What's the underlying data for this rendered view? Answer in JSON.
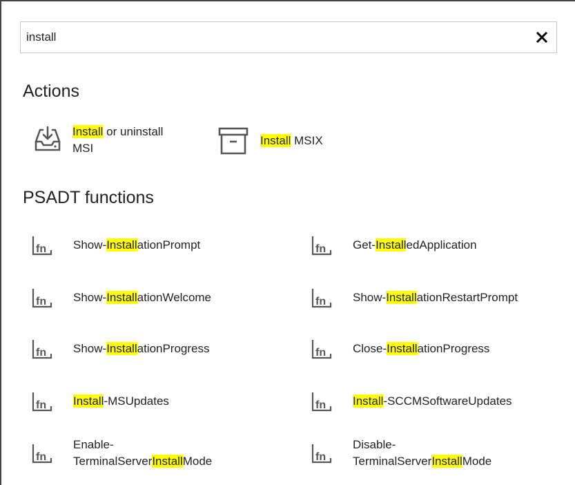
{
  "search": {
    "value": "install",
    "clear_icon": "close-icon"
  },
  "sections": {
    "actions_title": "Actions",
    "functions_title": "PSADT functions"
  },
  "actions": [
    {
      "icon": "tray-download-icon",
      "match": "Install",
      "rest": " or uninstall",
      "line2": "MSI"
    },
    {
      "icon": "archive-box-icon",
      "match": "Install",
      "rest": " MSIX",
      "line2": ""
    }
  ],
  "functions": [
    {
      "pre": "Show-",
      "match": "Install",
      "post": "ationPrompt",
      "pre2": ""
    },
    {
      "pre": "Get-",
      "match": "Install",
      "post": "edApplication",
      "pre2": ""
    },
    {
      "pre": "Show-",
      "match": "Install",
      "post": "ationWelcome",
      "pre2": ""
    },
    {
      "pre": "Show-",
      "match": "Install",
      "post": "ationRestartPrompt",
      "pre2": ""
    },
    {
      "pre": "Show-",
      "match": "Install",
      "post": "ationProgress",
      "pre2": ""
    },
    {
      "pre": "Close-",
      "match": "Install",
      "post": "ationProgress",
      "pre2": ""
    },
    {
      "pre": "",
      "match": "Install",
      "post": "-MSUpdates",
      "pre2": ""
    },
    {
      "pre": "",
      "match": "Install",
      "post": "-SCCMSoftwareUpdates",
      "pre2": ""
    },
    {
      "pre": "Enable-",
      "pre2": "TerminalServer",
      "match": "Install",
      "post": "Mode"
    },
    {
      "pre": "Disable-",
      "pre2": "TerminalServer",
      "match": "Install",
      "post": "Mode"
    }
  ],
  "colors": {
    "highlight": "#ffff00",
    "icon": "#555555"
  }
}
